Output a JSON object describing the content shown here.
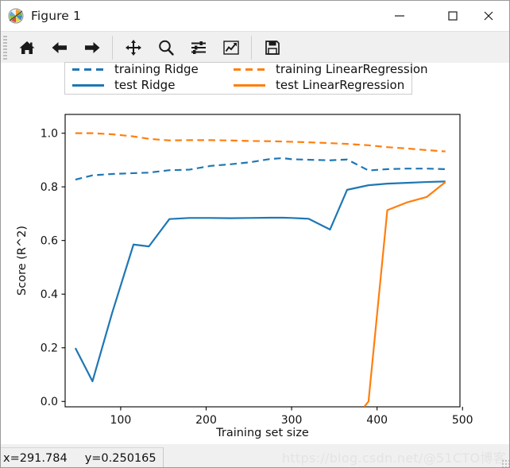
{
  "window": {
    "title": "Figure 1",
    "icon": "matplotlib-logo-icon",
    "minimize_label": "─",
    "maximize_label": "□",
    "close_label": "✕"
  },
  "toolbar": {
    "buttons": [
      {
        "name": "home-icon",
        "tooltip": "Reset original view"
      },
      {
        "name": "back-arrow-icon",
        "tooltip": "Back to previous view"
      },
      {
        "name": "forward-arrow-icon",
        "tooltip": "Forward to next view"
      },
      {
        "name": "pan-move-icon",
        "tooltip": "Pan axes with left mouse, zoom with right"
      },
      {
        "name": "zoom-magnifier-icon",
        "tooltip": "Zoom to rectangle"
      },
      {
        "name": "configure-subplots-sliders-icon",
        "tooltip": "Configure subplots"
      },
      {
        "name": "edit-axis-curve-chart-icon",
        "tooltip": "Edit axis, curve and image parameters"
      },
      {
        "name": "save-floppy-icon",
        "tooltip": "Save the figure"
      }
    ]
  },
  "statusbar": {
    "x_readout": "x=291.784",
    "y_readout": "y=0.250165",
    "watermark": "https://blog.csdn.net/@51CTO博客"
  },
  "colors": {
    "blue": "#1f77b4",
    "orange": "#ff7f0e",
    "axis": "#000000",
    "figure_background": "#ffffff",
    "chrome_background": "#f0f0f0"
  },
  "chart_data": {
    "type": "line",
    "title": "",
    "xlabel": "Training set size",
    "ylabel": "Score (R^2)",
    "xlim": [
      35,
      497
    ],
    "ylim": [
      -0.02,
      1.07
    ],
    "xticks": [
      100,
      200,
      300,
      400,
      500
    ],
    "xticklabels": [
      "100",
      "200",
      "300",
      "400",
      "500"
    ],
    "yticks": [
      0.0,
      0.2,
      0.4,
      0.6,
      0.8,
      1.0
    ],
    "yticklabels": [
      "0.0",
      "0.2",
      "0.4",
      "0.6",
      "0.8",
      "1.0"
    ],
    "grid": false,
    "legend_position": "upper center",
    "legend_ncol": 2,
    "series": [
      {
        "name": "training Ridge",
        "color": "#1f77b4",
        "linestyle": "dashed",
        "x": [
          47,
          67,
          90,
          115,
          133,
          157,
          180,
          205,
          228,
          252,
          275,
          290,
          300,
          320,
          345,
          365,
          390,
          412,
          435,
          458,
          480
        ],
        "values": [
          0.827,
          0.843,
          0.848,
          0.851,
          0.853,
          0.862,
          0.864,
          0.878,
          0.884,
          0.892,
          0.904,
          0.907,
          0.903,
          0.901,
          0.899,
          0.902,
          0.861,
          0.866,
          0.868,
          0.868,
          0.866
        ]
      },
      {
        "name": "test Ridge",
        "color": "#1f77b4",
        "linestyle": "solid",
        "x": [
          47,
          67,
          90,
          115,
          133,
          157,
          180,
          205,
          228,
          252,
          275,
          290,
          300,
          320,
          345,
          365,
          390,
          412,
          435,
          458,
          480
        ],
        "values": [
          0.199,
          0.075,
          0.33,
          0.585,
          0.578,
          0.68,
          0.684,
          0.684,
          0.683,
          0.684,
          0.685,
          0.685,
          0.684,
          0.681,
          0.641,
          0.789,
          0.806,
          0.812,
          0.815,
          0.818,
          0.82
        ]
      },
      {
        "name": "training LinearRegression",
        "color": "#ff7f0e",
        "linestyle": "dashed",
        "x": [
          47,
          67,
          90,
          115,
          133,
          157,
          180,
          205,
          228,
          252,
          275,
          290,
          300,
          320,
          345,
          365,
          390,
          412,
          435,
          458,
          480
        ],
        "values": [
          1.0,
          1.0,
          0.996,
          0.988,
          0.979,
          0.973,
          0.974,
          0.974,
          0.973,
          0.971,
          0.97,
          0.969,
          0.968,
          0.966,
          0.963,
          0.96,
          0.955,
          0.948,
          0.943,
          0.937,
          0.932
        ]
      },
      {
        "name": "test LinearRegression",
        "color": "#ff7f0e",
        "linestyle": "solid",
        "x": [
          385,
          390,
          412,
          435,
          458,
          480
        ],
        "values": [
          -0.02,
          0.0,
          0.713,
          0.742,
          0.762,
          0.818
        ]
      }
    ]
  },
  "legend": {
    "entries": [
      {
        "label": "training Ridge",
        "color": "#1f77b4",
        "style": "dashed"
      },
      {
        "label": "training LinearRegression",
        "color": "#ff7f0e",
        "style": "dashed"
      },
      {
        "label": "test Ridge",
        "color": "#1f77b4",
        "style": "solid"
      },
      {
        "label": "test LinearRegression",
        "color": "#ff7f0e",
        "style": "solid"
      }
    ]
  }
}
